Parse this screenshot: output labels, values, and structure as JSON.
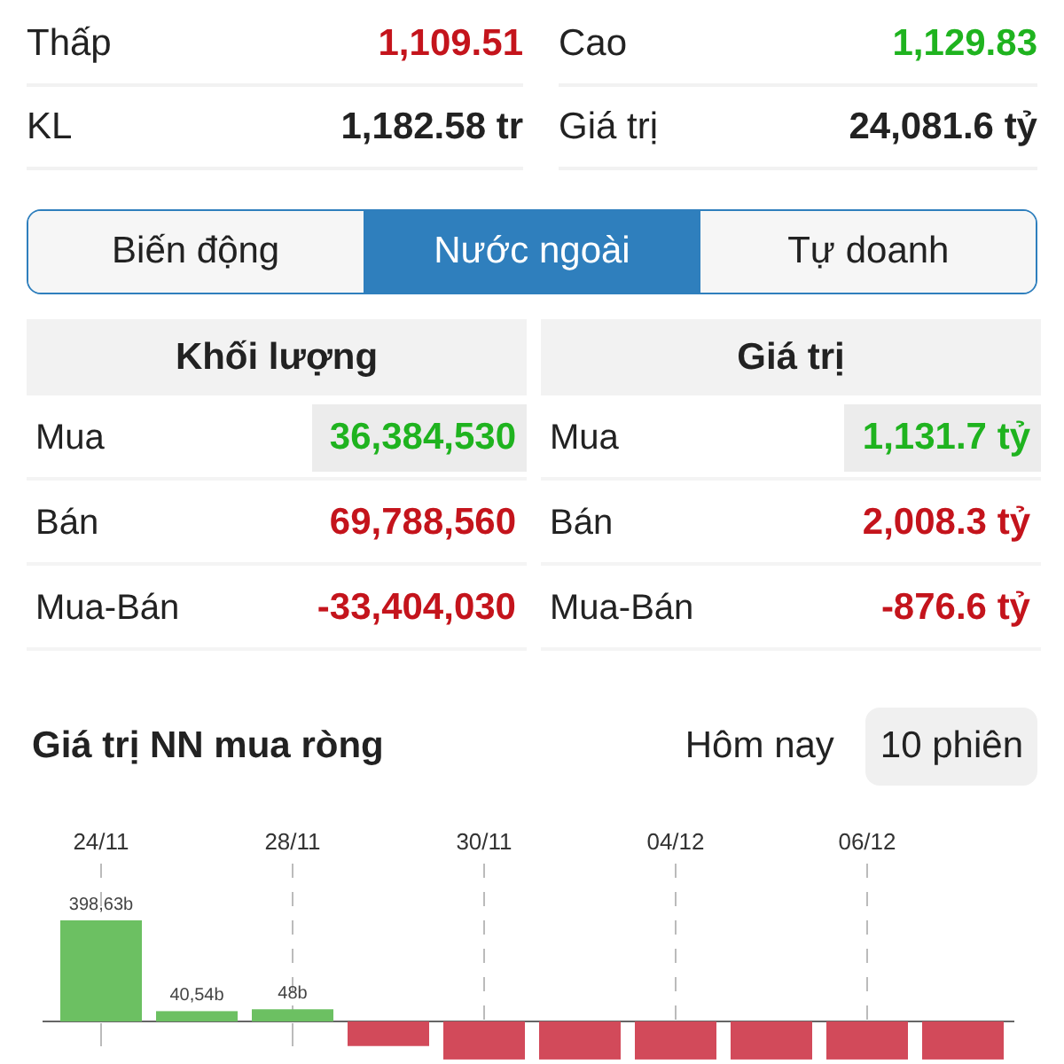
{
  "summary": [
    {
      "label": "Thấp",
      "value": "1,109.51",
      "color": "#c4141c"
    },
    {
      "label": "Cao",
      "value": "1,129.83",
      "color": "#1fb31f"
    },
    {
      "label": "KL",
      "value": "1,182.58 tr"
    },
    {
      "label": "Giá trị",
      "value": "24,081.6 tỷ"
    }
  ],
  "tabs": [
    {
      "label": "Biến động",
      "selected": false
    },
    {
      "label": "Nước ngoài",
      "selected": true
    },
    {
      "label": "Tự doanh",
      "selected": false
    }
  ],
  "tables": [
    {
      "title": "Khối lượng",
      "rows": [
        {
          "label": "Mua",
          "value": "36,384,530",
          "color": "#1fb31f",
          "highlighted": true
        },
        {
          "label": "Bán",
          "value": "69,788,560",
          "color": "#c4141c",
          "highlighted": false
        },
        {
          "label": "Mua-Bán",
          "value": "-33,404,030",
          "color": "#c4141c",
          "highlighted": false
        }
      ]
    },
    {
      "title": "Giá trị",
      "rows": [
        {
          "label": "Mua",
          "value": "1,131.7 tỷ",
          "color": "#1fb31f",
          "highlighted": true
        },
        {
          "label": "Bán",
          "value": "2,008.3 tỷ",
          "color": "#c4141c",
          "highlighted": false
        },
        {
          "label": "Mua-Bán",
          "value": "-876.6 tỷ",
          "color": "#c4141c",
          "highlighted": false
        }
      ]
    }
  ],
  "chart_section": {
    "title": "Giá trị NN mua ròng",
    "periods": [
      {
        "label": "Hôm nay",
        "selected": false
      },
      {
        "label": "10 phiên",
        "selected": true
      }
    ],
    "chart_data": {
      "type": "bar",
      "categories": [
        "24/11",
        null,
        "28/11",
        null,
        "30/11",
        null,
        "04/12",
        null,
        "06/12",
        null
      ],
      "values": [
        398.63,
        40.54,
        48,
        -97,
        -150,
        -150,
        -150,
        -150,
        -150,
        -150
      ],
      "grid": true,
      "value_labels": [
        "398,63b",
        "40,54b",
        "48b",
        null,
        null,
        null,
        null,
        null,
        null,
        null
      ]
    }
  }
}
